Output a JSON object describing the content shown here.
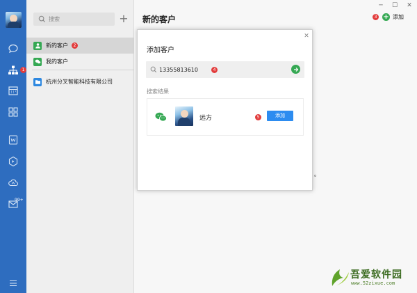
{
  "colors": {
    "rail": "#2e6dbf",
    "accent_green": "#35a853",
    "button_blue": "#2d8cf0",
    "badge_red": "#e23b3b"
  },
  "rail": {
    "icons": [
      "avatar",
      "chat-bubble-icon",
      "org-chart-icon",
      "calendar-icon",
      "apps-grid-icon",
      "document-icon",
      "cube-icon",
      "cloud-drive-icon",
      "mail-icon",
      "menu-icon"
    ],
    "org_badge": "1",
    "mail_count": "99+"
  },
  "sidebar": {
    "search_placeholder": "搜索",
    "items": [
      {
        "label": "新的客户",
        "badge": "2",
        "icon": "new-customer-icon"
      },
      {
        "label": "我的客户",
        "icon": "my-customer-icon"
      },
      {
        "label": "杭州分叉智能科技有限公司",
        "icon": "folder-icon"
      }
    ]
  },
  "main": {
    "title": "新的客户",
    "add_badge": "3",
    "add_label": "添加",
    "background_text": "。"
  },
  "dialog": {
    "title": "添加客户",
    "search_value": "13355813610",
    "search_badge": "4",
    "results_label": "搜索结果",
    "result": {
      "name": "远方",
      "badge": "5",
      "button_label": "添加"
    }
  },
  "watermark": {
    "text": "吾爱软件园",
    "url": "www.52zixue.com"
  }
}
